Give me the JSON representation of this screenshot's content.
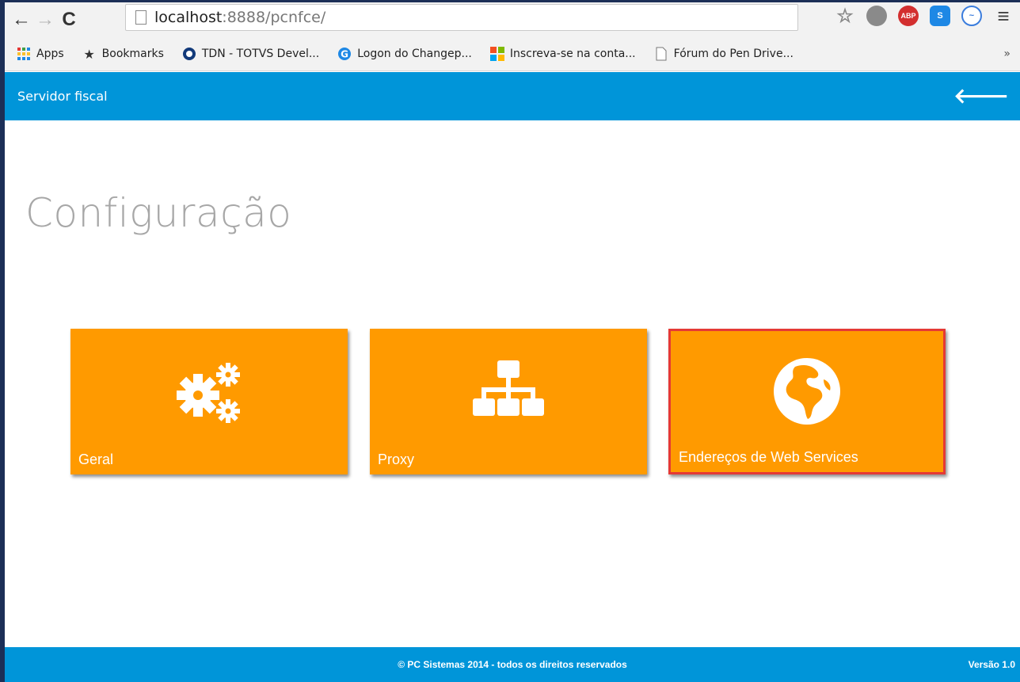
{
  "browser": {
    "url_host": "localhost",
    "url_rest": ":8888/pcnfce/",
    "extensions": [
      "ABP",
      "S"
    ]
  },
  "bookmarks": [
    {
      "label": "Apps",
      "icon": "apps-grid-icon"
    },
    {
      "label": "Bookmarks",
      "icon": "star-icon"
    },
    {
      "label": "TDN - TOTVS Devel...",
      "icon": "circle-logo-icon"
    },
    {
      "label": "Logon do Changep...",
      "icon": "g-logo-icon"
    },
    {
      "label": "Inscreva-se na conta...",
      "icon": "windows-logo-icon"
    },
    {
      "label": "Fórum do Pen Drive...",
      "icon": "page-icon"
    }
  ],
  "bookmarks_more": "»",
  "header": {
    "title": "Servidor fiscal"
  },
  "page": {
    "title": "Configuração"
  },
  "tiles": [
    {
      "label": "Geral",
      "icon": "gears-icon"
    },
    {
      "label": "Proxy",
      "icon": "sitemap-icon"
    },
    {
      "label": "Endereços de Web Services",
      "icon": "globe-icon",
      "selected": true
    }
  ],
  "footer": {
    "copyright": "© PC Sistemas 2014 - todos os direitos reservados",
    "version": "Versão 1.0"
  },
  "colors": {
    "accent": "#0095d9",
    "tile": "#ff9a00",
    "selection": "#e53935",
    "title_gray": "#a7a7a7"
  }
}
